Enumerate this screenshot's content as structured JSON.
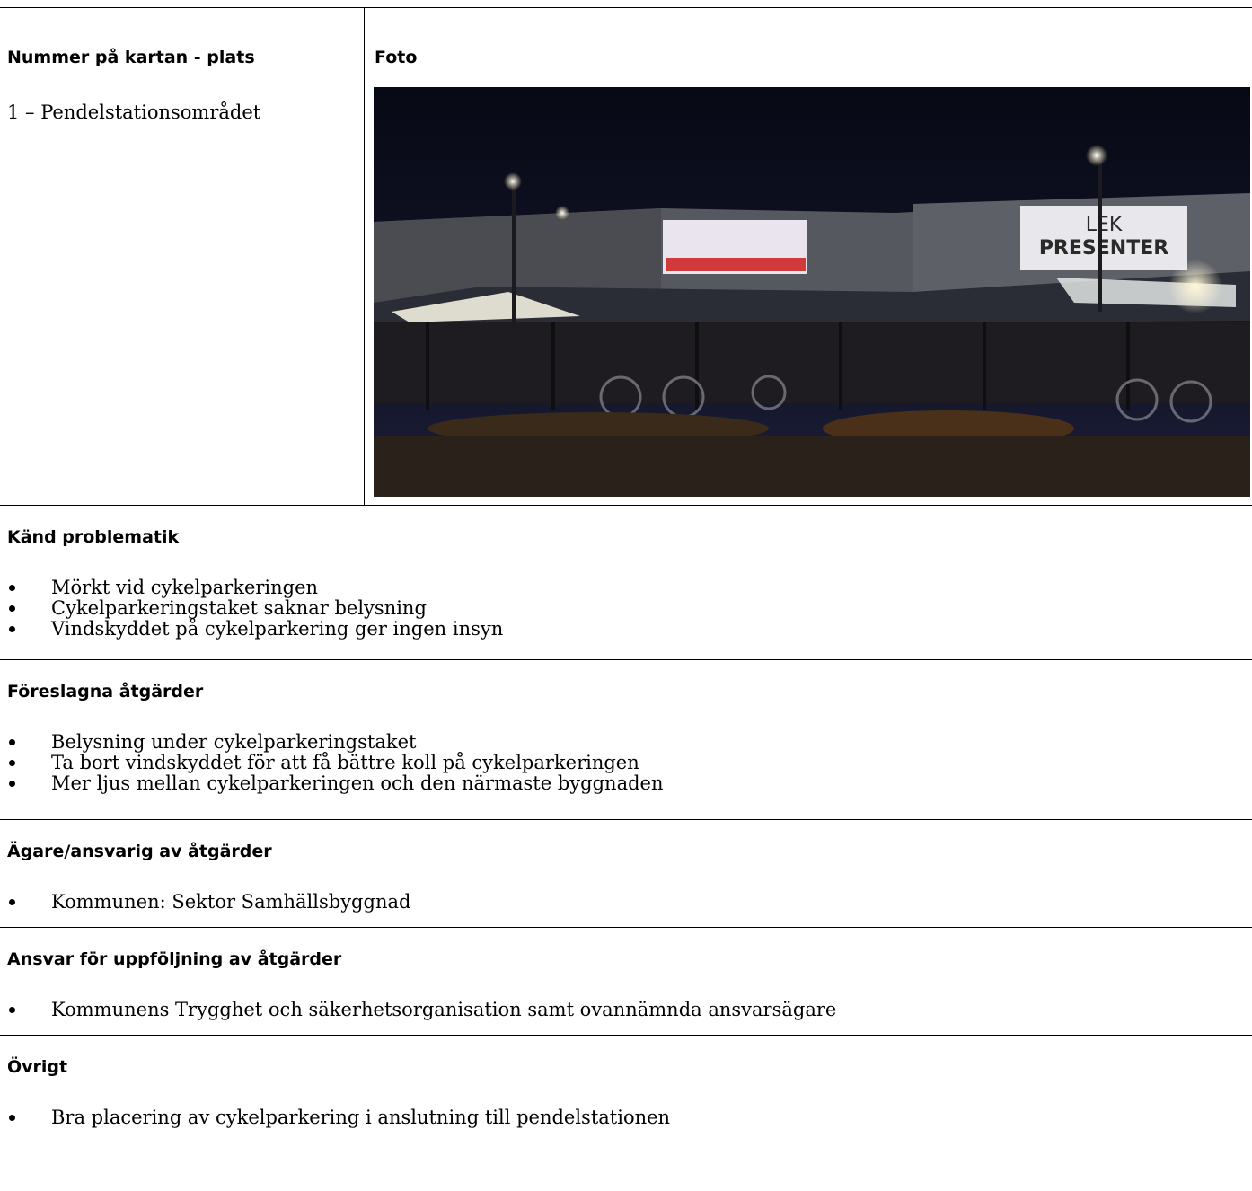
{
  "left_column": {
    "heading": "Nummer på kartan - plats",
    "place": "1 – Pendelstationsområdet"
  },
  "photo_column": {
    "heading": "Foto",
    "sign_text_line1": "LEK",
    "sign_text_line2": "PRESENTER"
  },
  "sections": [
    {
      "heading": "Känd problematik",
      "items": [
        "Mörkt vid cykelparkeringen",
        "Cykelparkeringstaket saknar belysning",
        "Vindskyddet på cykelparkering ger ingen insyn"
      ]
    },
    {
      "heading": "Föreslagna åtgärder",
      "items": [
        "Belysning under cykelparkeringstaket",
        "Ta bort vindskyddet för att få bättre koll på cykelparkeringen",
        "Mer ljus mellan cykelparkeringen och den närmaste byggnaden"
      ]
    },
    {
      "heading": "Ägare/ansvarig av åtgärder",
      "items": [
        "Kommunen: Sektor Samhällsbyggnad"
      ]
    },
    {
      "heading": "Ansvar för uppföljning av åtgärder",
      "items": [
        "Kommunens Trygghet och säkerhetsorganisation samt ovannämnda ansvarsägare"
      ]
    },
    {
      "heading": "Övrigt",
      "items": [
        "Bra placering av cykelparkering i anslutning till pendelstationen"
      ]
    }
  ],
  "colors": {
    "text": "#000000",
    "border": "#000000",
    "photo_sky": "#0b0d1e"
  }
}
